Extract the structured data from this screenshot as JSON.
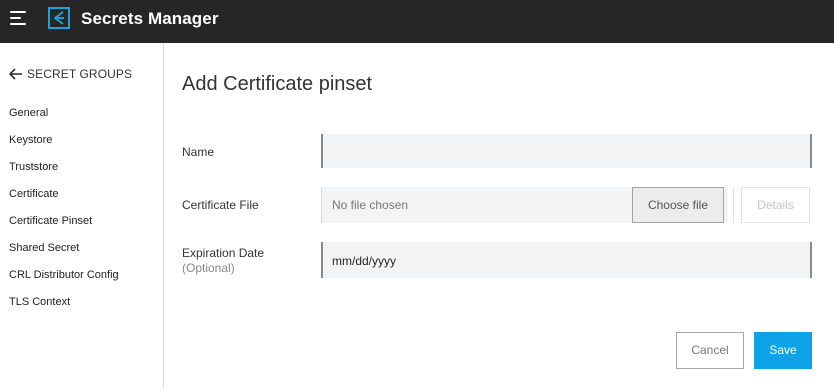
{
  "header": {
    "title": "Secrets Manager",
    "menu_icon": "hamburger-menu-icon",
    "logo_icon": "secrets-manager-logo-icon",
    "background": "#262626",
    "logo_color": "#1ba1e2"
  },
  "sidebar": {
    "back_label": "SECRET GROUPS",
    "back_icon": "arrow-left-icon",
    "items": [
      {
        "label": "General"
      },
      {
        "label": "Keystore"
      },
      {
        "label": "Truststore"
      },
      {
        "label": "Certificate"
      },
      {
        "label": "Certificate Pinset"
      },
      {
        "label": "Shared Secret"
      },
      {
        "label": "CRL Distributor Config"
      },
      {
        "label": "TLS Context"
      }
    ]
  },
  "form": {
    "title": "Add Certificate pinset",
    "name_label": "Name",
    "name_value": "",
    "file_label": "Certificate File",
    "file_status": "No file chosen",
    "choose_file_label": "Choose file",
    "details_label": "Details",
    "expiration_label": "Expiration Date",
    "expiration_optional": "(Optional)",
    "expiration_value": "mm/dd/yyyy"
  },
  "actions": {
    "cancel_label": "Cancel",
    "save_label": "Save",
    "primary_color": "#0ea3e6"
  }
}
